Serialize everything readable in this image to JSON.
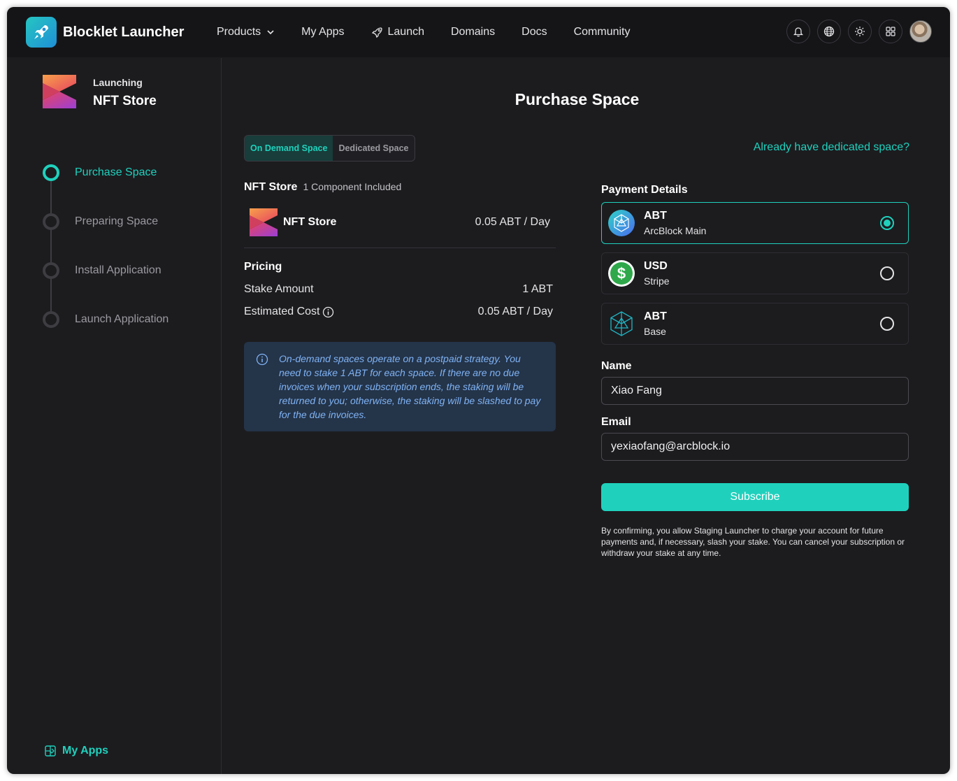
{
  "header": {
    "brand": "Blocklet Launcher",
    "nav": [
      {
        "label": "Products",
        "has_dropdown": true
      },
      {
        "label": "My Apps"
      },
      {
        "label": "Launch",
        "icon": "rocket-icon"
      },
      {
        "label": "Domains"
      },
      {
        "label": "Docs"
      },
      {
        "label": "Community"
      }
    ],
    "icons": [
      "bell-icon",
      "globe-icon",
      "sun-icon",
      "apps-grid-icon",
      "user-avatar"
    ]
  },
  "sidebar": {
    "launching_label": "Launching",
    "app_name": "NFT Store",
    "steps": [
      {
        "label": "Purchase Space",
        "active": true
      },
      {
        "label": "Preparing Space",
        "active": false
      },
      {
        "label": "Install Application",
        "active": false
      },
      {
        "label": "Launch Application",
        "active": false
      }
    ],
    "my_apps_label": "My Apps"
  },
  "main": {
    "title": "Purchase Space",
    "tabs": [
      {
        "label": "On Demand Space",
        "active": true
      },
      {
        "label": "Dedicated Space",
        "active": false
      }
    ],
    "dedicated_link": "Already have dedicated space?",
    "component": {
      "name": "NFT Store",
      "count_text": "1 Component Included",
      "item_name": "NFT Store",
      "item_price": "0.05 ABT / Day"
    },
    "pricing": {
      "title": "Pricing",
      "stake_label": "Stake Amount",
      "stake_value": "1 ABT",
      "cost_label": "Estimated Cost",
      "cost_value": "0.05 ABT / Day"
    },
    "notice": "On-demand spaces operate on a postpaid strategy. You need to stake 1 ABT for each space. If there are no due invoices when your subscription ends, the staking will be returned to you; otherwise, the staking will be slashed to pay for the due invoices.",
    "payment": {
      "title": "Payment Details",
      "options": [
        {
          "currency": "ABT",
          "method": "ArcBlock Main",
          "selected": true,
          "icon": "arcblock-main-icon"
        },
        {
          "currency": "USD",
          "method": "Stripe",
          "selected": false,
          "icon": "dollar-icon"
        },
        {
          "currency": "ABT",
          "method": "Base",
          "selected": false,
          "icon": "arcblock-base-icon"
        }
      ]
    },
    "form": {
      "name_label": "Name",
      "name_value": "Xiao Fang",
      "email_label": "Email",
      "email_value": "yexiaofang@arcblock.io"
    },
    "subscribe_label": "Subscribe",
    "disclaimer": "By confirming, you allow Staging Launcher to charge your account for future payments and, if necessary, slash your stake. You can cancel your subscription or withdraw your stake at any time."
  },
  "colors": {
    "accent": "#1fd1bd",
    "background": "#1c1c1f",
    "header": "#151518",
    "notice_bg": "#243449",
    "notice_text": "#7fb3f5"
  }
}
